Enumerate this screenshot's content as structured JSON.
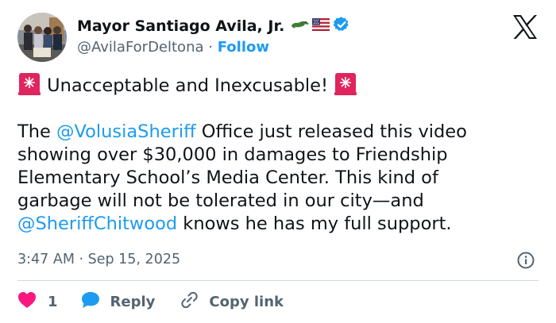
{
  "author": {
    "name": "Mayor Santiago Avila, Jr.",
    "handle": "@AvilaForDeltona",
    "separator": "·",
    "follow_label": "Follow"
  },
  "post": {
    "headline": "Unacceptable and Inexcusable!",
    "line1_pre": "The ",
    "line1_mention": "@VolusiaSheriff",
    "line1_post": " Office just released this video",
    "line2": "showing over $30,000 in damages to Friendship",
    "line3": "Elementary School’s Media Center. This kind of",
    "line4": "garbage will not be tolerated in our city—and",
    "line5_mention": "@SheriffChitwood",
    "line5_post": " knows he has my full support.",
    "timestamp": "3:47 AM · Sep 15, 2025"
  },
  "actions": {
    "like_count": "1",
    "reply_label": "Reply",
    "copy_link_label": "Copy link"
  },
  "colors": {
    "accent": "#1d9bf0",
    "heart": "#f91880",
    "siren": "#e0245e",
    "muted": "#536471"
  }
}
